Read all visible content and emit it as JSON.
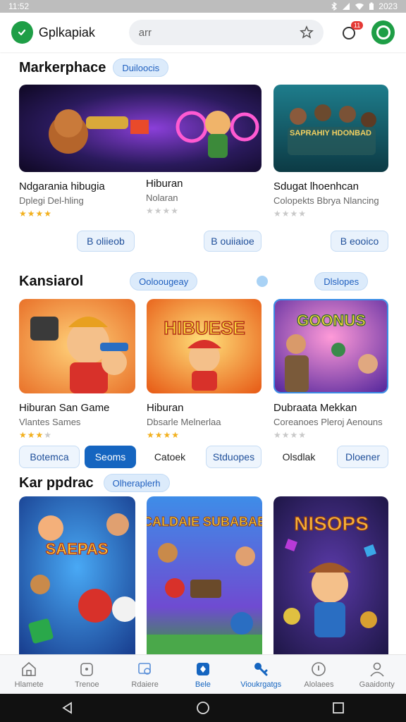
{
  "status": {
    "time": "11:52",
    "battery": "2023"
  },
  "app": {
    "name": "Gplkapiak"
  },
  "search": {
    "value": "arr"
  },
  "notifications": {
    "badge": "11"
  },
  "sections": {
    "marketplace": {
      "title": "Markerphace",
      "pill": "Duiloocis",
      "cards": [
        {
          "title": "Ndgarania hibugia",
          "subtitle": "Dplegi Del-hling",
          "rating": 4,
          "button": "B oliieob"
        },
        {
          "title": "Hiburan",
          "subtitle": "Nolaran",
          "rating": 0,
          "button": "B ouiiaioe"
        },
        {
          "title": "Sdugat lhoenhcan",
          "subtitle": "Colopekts Bbrya Nlancing",
          "rating": 0,
          "button": "B eooico"
        }
      ]
    },
    "kansiarol": {
      "title": "Kansiarol",
      "pill": "Ooloougeay",
      "pill2": "Dlslopes",
      "cards": [
        {
          "title": "Hiburan  San Game",
          "subtitle": "Vlantes Sames",
          "rating": 3
        },
        {
          "title": "Hiburan",
          "subtitle": "Dbsarle Melnerlaa",
          "rating": 4
        },
        {
          "title": "Dubraata Mekkan",
          "subtitle": "Coreanoes Pleroj Aenouns",
          "rating": 0
        }
      ]
    },
    "segments": [
      {
        "label": "Botemca",
        "style": "outline"
      },
      {
        "label": "Seoms",
        "style": "active"
      },
      {
        "label": "Catoek",
        "style": "plain"
      },
      {
        "label": "Stduopes",
        "style": "outline"
      },
      {
        "label": "Olsdlak",
        "style": "plain"
      },
      {
        "label": "Dloener",
        "style": "outline"
      }
    ],
    "karappdrac": {
      "title": "Kar  ppdrac",
      "pill": "Olheraplerh"
    }
  },
  "art": {
    "marketplace_3": "SAPRAHIY HDONBAD",
    "kansiarol_2": "HIBUESE",
    "kansiarol_3": "GOONUS",
    "karappdrac_1": "SAEPAS",
    "karappdrac_2": "CALDAIE SUBABAE",
    "karappdrac_3": "NISOPS"
  },
  "nav": [
    {
      "label": "Hlamete",
      "icon": "home-icon",
      "active": false
    },
    {
      "label": "Trenoe",
      "icon": "store-icon",
      "active": false
    },
    {
      "label": "Rdaiere",
      "icon": "library-icon",
      "active": false
    },
    {
      "label": "Bele",
      "icon": "games-icon",
      "active": true
    },
    {
      "label": "Vioukrgatgs",
      "icon": "key-icon",
      "active": true
    },
    {
      "label": "Alolaees",
      "icon": "info-icon",
      "active": false
    },
    {
      "label": "Gaaidonty",
      "icon": "profile-icon",
      "active": false
    }
  ],
  "colors": {
    "accent": "#1565c0",
    "brand": "#1e9e46",
    "star": "#f2b01e"
  }
}
